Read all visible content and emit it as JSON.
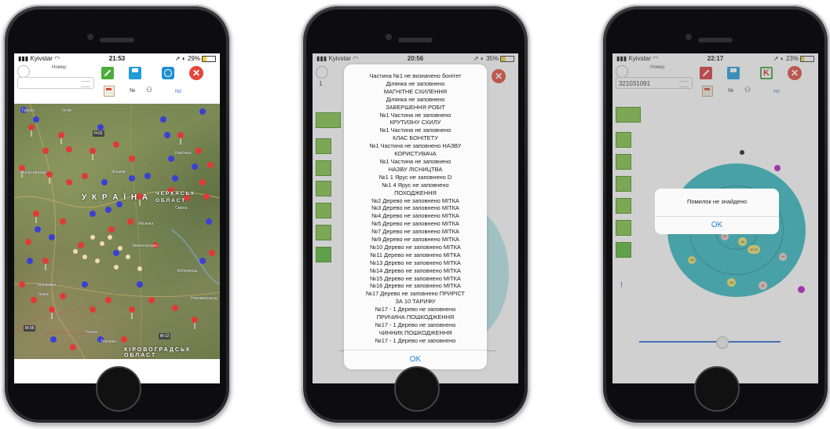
{
  "phone1": {
    "status": {
      "carrier": "Kyivstar",
      "time": "21:53",
      "battery": "29%",
      "battery_level": 0.29
    },
    "number_label": "Номер",
    "number_value": "",
    "no_label": "№",
    "nd_label": "Nd",
    "map": {
      "country_label": "У К Р А Ї Н А",
      "region_east": "ЧЕРКАСЬК ОБЛАСТ",
      "region_south": "КІРОВОГРАДСЬК ОБЛАСТ",
      "towns": [
        "Гайсин",
        "Умань",
        "Тальне",
        "Звенигородка",
        "Монастирище",
        "Маньківка",
        "Смела",
        "Кам'янка",
        "Лисянка",
        "Жашків",
        "Тетіїв",
        "Новомиргород",
        "Бобринець",
        "Торнівка"
      ],
      "roads": [
        "M-05",
        "M-12",
        "H-01"
      ]
    }
  },
  "phone2": {
    "status": {
      "carrier": "Kyivstar",
      "time": "20:56",
      "battery": "35%",
      "battery_level": 0.35
    },
    "number_value": "1",
    "alert_lines": [
      "Частина №1 не визначено бонітет",
      "Ділянка не заповнено",
      "МАГНІТНЕ СХИЛЕННЯ",
      "Ділянка не заповнено",
      "ЗАВЕРШЕННЯ РОБІТ",
      "№1 Частина не заповнено",
      "КРУТИЗНУ СХИЛУ",
      "№1 Частина не заповнено",
      "КЛАС БОНІТЕТУ",
      "№1 Частина не заповнено НАЗВУ",
      "КОРИСТУВАЧА",
      "№1 Частина не заповнено",
      "НАЗВУ ЛІСНИЦТВА",
      "№1 1 Ярус не заповнено D",
      "№1 4 Ярус не заповнено",
      "ПОХОДЖЕННЯ",
      "№2 Дерево не заповнено МІТКА",
      "№3 Дерево не заповнено МІТКА",
      "№4 Дерево не заповнено МІТКА",
      "№5 Дерево не заповнено МІТКА",
      "№7 Дерево не заповнено МІТКА",
      "№9 Дерево не заповнено МІТКА",
      "№10 Дерево не заповнено МІТКА",
      "№11 Дерево не заповнено МІТКА",
      "№13 Дерево не заповнено МІТКА",
      "№14 Дерево не заповнено МІТКА",
      "№15 Дерево не заповнено МІТКА",
      "№16 Дерево не заповнено МІТКА",
      "№17 Дерево не заповнено ПРИРІСТ",
      "ЗА 10 ТАРИФУ",
      "№17 - 1 Дерево не заповнено",
      "ПРИЧИНА ПОШКОДЖЕННЯ",
      "№17 - 1 Дерево не заповнено",
      "ЧИННИК ПОШКОДЖЕННЯ",
      "№17 - 1 Дерево не заповнено"
    ],
    "ok_label": "OK"
  },
  "phone3": {
    "status": {
      "carrier": "Kyivstar",
      "time": "22:17",
      "battery": "23%",
      "battery_level": 0.23
    },
    "number_label": "Номер",
    "number_value": "321031091",
    "no_label": "№",
    "nd_label": "Nd",
    "k_label": "K",
    "side_mark": "!",
    "alert_message": "Помилок не знайдено",
    "ok_label": "OK",
    "tree_numbers": [
      "16",
      "10 12",
      "18",
      "15",
      "11",
      "19",
      "20"
    ]
  },
  "colors": {
    "accent_blue": "#1e7fdc",
    "teal": "#2eb7bf",
    "close_red": "#e2473a",
    "green": "#53b632"
  }
}
